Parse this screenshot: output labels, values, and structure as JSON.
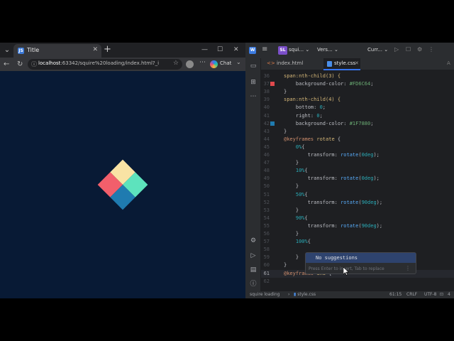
{
  "browser": {
    "tab_title": "Title",
    "tab_favicon": "JS",
    "url_host": "localhost",
    "url_rest": ":63342/squire%20loading/index.html?_ijt=...",
    "chat_label": "Chat",
    "diamond_colors": [
      "#f9e3a4",
      "#f25f6b",
      "#5de3bd",
      "#1f7bb0"
    ]
  },
  "ide": {
    "logo": "W",
    "project_badge": "SL",
    "project_name": "squi...",
    "vcs_label": "Vers...",
    "run_config": "Curr...",
    "tabs": [
      {
        "label": "index.html"
      },
      {
        "label": "style.css"
      }
    ],
    "lines": [
      {
        "n": "36",
        "text": "span:nth-child(3) {"
      },
      {
        "n": "37",
        "text": "    background-color: #FD6C64;",
        "swatch": "#e0494d"
      },
      {
        "n": "38",
        "text": "}"
      },
      {
        "n": "39",
        "text": "span:nth-child(4) {"
      },
      {
        "n": "40",
        "text": "    bottom: 0;"
      },
      {
        "n": "41",
        "text": "    right: 0;"
      },
      {
        "n": "42",
        "text": "    background-color: #1F7880;",
        "swatch": "#1f7bb0"
      },
      {
        "n": "43",
        "text": "}"
      },
      {
        "n": "44",
        "text": "@keyframes rotate {"
      },
      {
        "n": "45",
        "text": "    0%{"
      },
      {
        "n": "46",
        "text": "        transform: rotate(0deg);"
      },
      {
        "n": "47",
        "text": "    }"
      },
      {
        "n": "48",
        "text": "    10%{"
      },
      {
        "n": "49",
        "text": "        transform: rotate(0deg);"
      },
      {
        "n": "50",
        "text": "    }"
      },
      {
        "n": "51",
        "text": "    50%{"
      },
      {
        "n": "52",
        "text": "        transform: rotate(90deg);"
      },
      {
        "n": "53",
        "text": "    }"
      },
      {
        "n": "54",
        "text": "    90%{"
      },
      {
        "n": "55",
        "text": "        transform: rotate(90deg);"
      },
      {
        "n": "56",
        "text": "    }"
      },
      {
        "n": "57",
        "text": "    100%{"
      },
      {
        "n": "58",
        "text": ""
      },
      {
        "n": "59",
        "text": "    }"
      },
      {
        "n": "60",
        "text": "}"
      },
      {
        "n": "61",
        "text": "@keyframes ani {"
      },
      {
        "n": "62",
        "text": ""
      }
    ],
    "current_line": "61",
    "popup": {
      "item": "No suggestions",
      "hint": "Press Enter to insert, Tab to replace"
    },
    "status": {
      "breadcrumb_project": "squire loading",
      "breadcrumb_file": "style.css",
      "position": "61:15",
      "line_sep": "CRLF",
      "encoding": "UTF-8",
      "indent": "4"
    }
  }
}
